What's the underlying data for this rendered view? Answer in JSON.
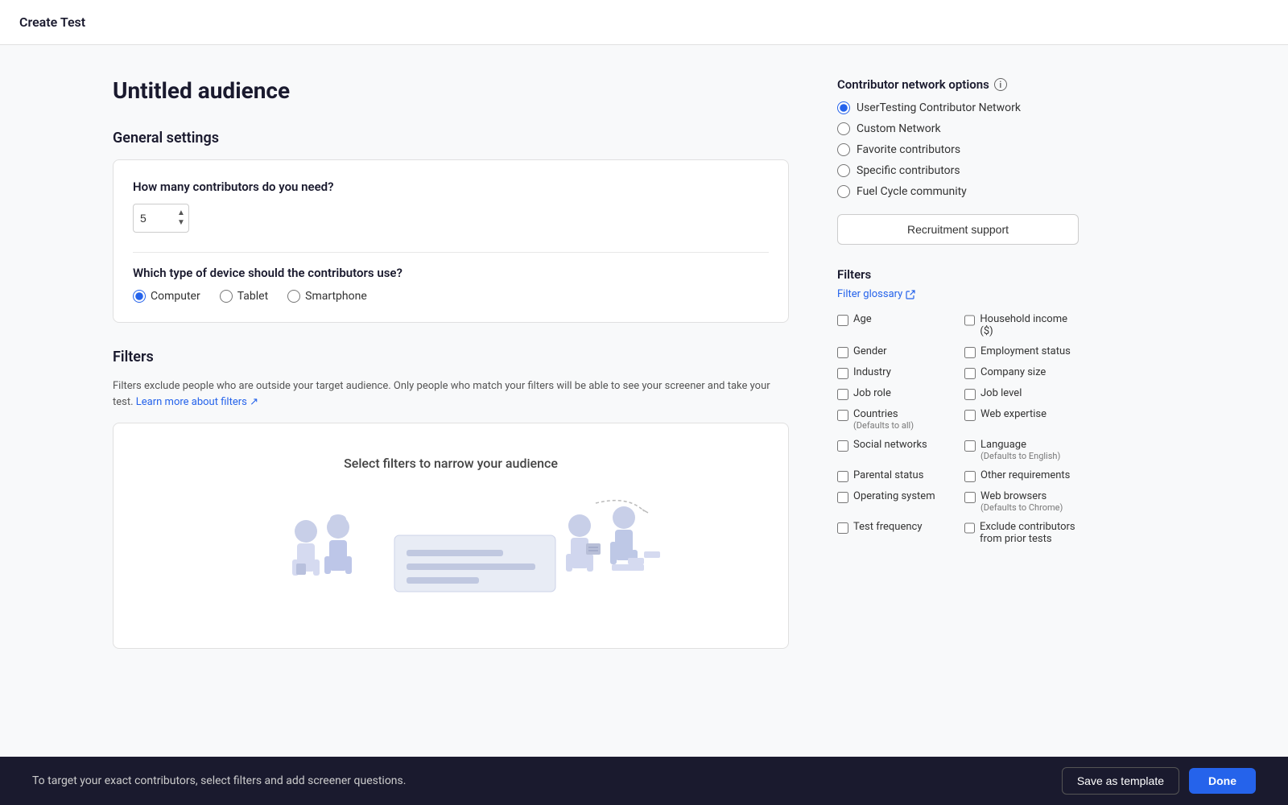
{
  "header": {
    "title": "Create Test"
  },
  "page": {
    "title": "Untitled audience"
  },
  "general_settings": {
    "section_title": "General settings",
    "contributors_question": "How many contributors do you need?",
    "contributors_value": "5",
    "device_question": "Which type of device should the contributors use?",
    "device_options": [
      {
        "label": "Computer",
        "value": "computer",
        "selected": true
      },
      {
        "label": "Tablet",
        "value": "tablet",
        "selected": false
      },
      {
        "label": "Smartphone",
        "value": "smartphone",
        "selected": false
      }
    ]
  },
  "filters_section": {
    "title": "Filters",
    "description": "Filters exclude people who are outside your target audience. Only people who match your filters will be able to see your screener and take your test.",
    "learn_more_text": "Learn more about filters",
    "empty_state_text": "Select filters to narrow your audience"
  },
  "right_panel": {
    "contributor_network_title": "Contributor network options",
    "network_options": [
      {
        "label": "UserTesting Contributor Network",
        "selected": true
      },
      {
        "label": "Custom Network",
        "selected": false
      },
      {
        "label": "Favorite contributors",
        "selected": false
      },
      {
        "label": "Specific contributors",
        "selected": false
      },
      {
        "label": "Fuel Cycle community",
        "selected": false
      }
    ],
    "recruitment_button": "Recruitment support",
    "filters_title": "Filters",
    "filter_glossary_link": "Filter glossary",
    "filter_items": [
      {
        "label": "Age",
        "sub": ""
      },
      {
        "label": "Household income ($)",
        "sub": ""
      },
      {
        "label": "Gender",
        "sub": ""
      },
      {
        "label": "Employment status",
        "sub": ""
      },
      {
        "label": "Industry",
        "sub": ""
      },
      {
        "label": "Company size",
        "sub": ""
      },
      {
        "label": "Job role",
        "sub": ""
      },
      {
        "label": "Job level",
        "sub": ""
      },
      {
        "label": "Countries",
        "sub": "(Defaults to all)"
      },
      {
        "label": "Web expertise",
        "sub": ""
      },
      {
        "label": "Social networks",
        "sub": ""
      },
      {
        "label": "Language",
        "sub": "(Defaults to English)"
      },
      {
        "label": "Parental status",
        "sub": ""
      },
      {
        "label": "Other requirements",
        "sub": ""
      },
      {
        "label": "Operating system",
        "sub": ""
      },
      {
        "label": "Web browsers",
        "sub": "(Defaults to Chrome)"
      },
      {
        "label": "Test frequency",
        "sub": ""
      },
      {
        "label": "Exclude contributors from prior tests",
        "sub": ""
      }
    ]
  },
  "bottom_bar": {
    "info_text": "To target your exact contributors, select filters and add screener questions.",
    "save_template_label": "Save as template",
    "done_label": "Done"
  }
}
